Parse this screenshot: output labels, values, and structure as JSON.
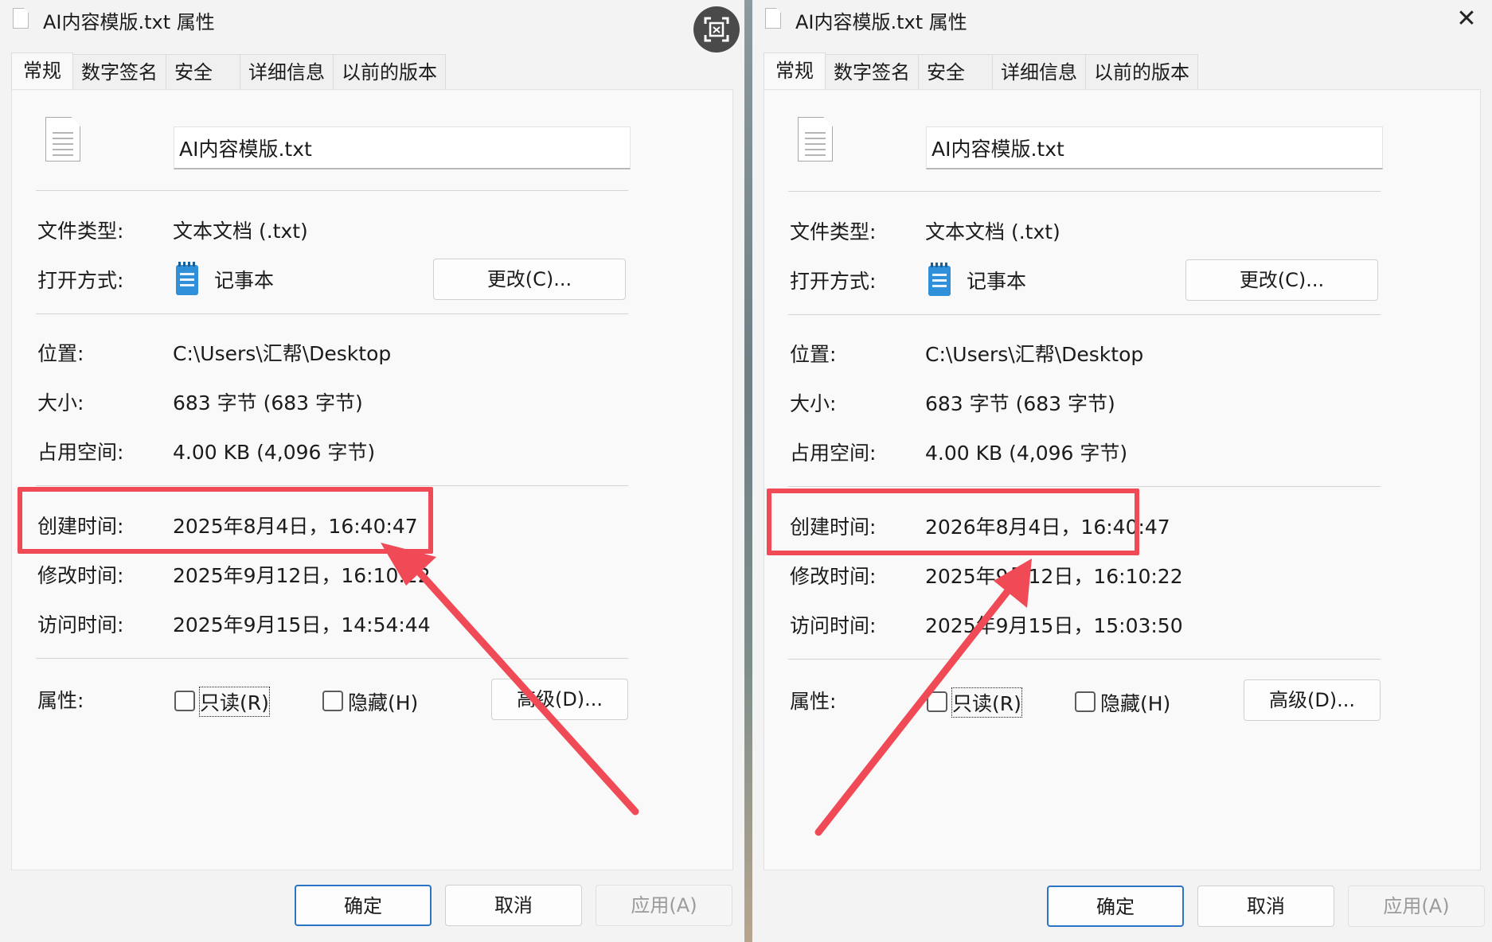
{
  "left": {
    "title": "AI内容模版.txt 属性",
    "tabs": [
      "常规",
      "数字签名",
      "安全",
      "详细信息",
      "以前的版本"
    ],
    "filename": "AI内容模版.txt",
    "type_label": "文件类型:",
    "type_value": "文本文档 (.txt)",
    "open_label": "打开方式:",
    "open_value": "记事本",
    "change_button": "更改(C)...",
    "location_label": "位置:",
    "location_value": "C:\\Users\\汇帮\\Desktop",
    "size_label": "大小:",
    "size_value": "683 字节 (683 字节)",
    "disk_label": "占用空间:",
    "disk_value": "4.00 KB (4,096 字节)",
    "created_label": "创建时间:",
    "created_value": "2025年8月4日，16:40:47",
    "modified_label": "修改时间:",
    "modified_value": "2025年9月12日，16:10:22",
    "accessed_label": "访问时间:",
    "accessed_value": "2025年9月15日，14:54:44",
    "attr_label": "属性:",
    "readonly_label": "只读(R)",
    "hidden_label": "隐藏(H)",
    "advanced_button": "高级(D)...",
    "ok_button": "确定",
    "cancel_button": "取消",
    "apply_button": "应用(A)"
  },
  "right": {
    "title": "AI内容模版.txt 属性",
    "tabs": [
      "常规",
      "数字签名",
      "安全",
      "详细信息",
      "以前的版本"
    ],
    "filename": "AI内容模版.txt",
    "type_label": "文件类型:",
    "type_value": "文本文档 (.txt)",
    "open_label": "打开方式:",
    "open_value": "记事本",
    "change_button": "更改(C)...",
    "location_label": "位置:",
    "location_value": "C:\\Users\\汇帮\\Desktop",
    "size_label": "大小:",
    "size_value": "683 字节 (683 字节)",
    "disk_label": "占用空间:",
    "disk_value": "4.00 KB (4,096 字节)",
    "created_label": "创建时间:",
    "created_value": "2026年8月4日，16:40:47",
    "modified_label": "修改时间:",
    "modified_value": "2025年9月12日，16:10:22",
    "accessed_label": "访问时间:",
    "accessed_value": "2025年9月15日，15:03:50",
    "attr_label": "属性:",
    "readonly_label": "只读(R)",
    "hidden_label": "隐藏(H)",
    "advanced_button": "高级(D)...",
    "ok_button": "确定",
    "cancel_button": "取消",
    "apply_button": "应用(A)"
  },
  "annotation_color": "#ef4a56",
  "icons": [
    "file-icon",
    "notepad-icon",
    "close-icon",
    "screen-capture-icon",
    "arrow-annotation"
  ]
}
